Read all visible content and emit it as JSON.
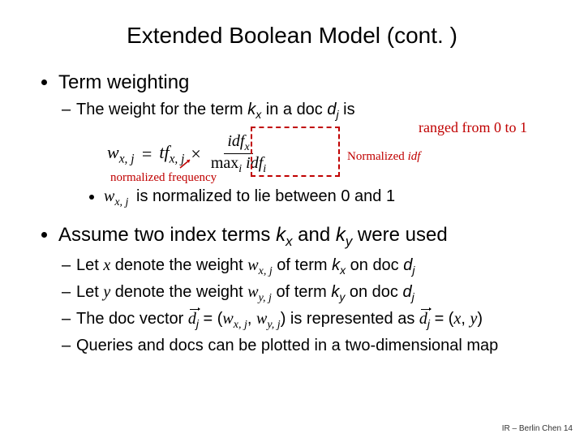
{
  "title": "Extended Boolean Model (cont. )",
  "b1": {
    "heading": "Term weighting",
    "sub1_pre": "The weight for the term ",
    "sub1_k": "k",
    "sub1_x": "x",
    "sub1_mid": " in a doc ",
    "sub1_d": "d",
    "sub1_j": "j",
    "sub1_post": " is"
  },
  "formula": {
    "lhs_w": "w",
    "lhs_sub": "x, j",
    "eq": "=",
    "tf": "tf",
    "tf_sub": "x, j",
    "times": "×",
    "num_idf": "idf",
    "num_sub": "x",
    "den_max": "max",
    "den_i": "i",
    "den_idf": " idf",
    "den_isub": "i"
  },
  "range_note": "ranged from 0 to 1",
  "norm_freq": "normalized frequency",
  "norm_idf_pre": "Normalized ",
  "norm_idf_it": "idf",
  "normline": " is normalized to lie between 0 and 1",
  "b2": {
    "heading_pre": "Assume two index terms ",
    "kx_k": "k",
    "kx_x": "x",
    "and": " and ",
    "ky_k": "k",
    "ky_y": "y",
    "heading_post": " were used",
    "l1_let": "Let ",
    "l1_x": "x",
    "l1_mid": " denote the weight ",
    "l1_w": "w",
    "l1_wsub": "x, j",
    "l1_of": " of term ",
    "l1_k": "k",
    "l1_kx": "x",
    "l1_on": " on doc ",
    "l1_d": "d",
    "l1_j": "j",
    "l2_let": "Let ",
    "l2_y": "y",
    "l2_mid": " denote the weight ",
    "l2_w": "w",
    "l2_wsub": "y, j",
    "l2_of": " of term ",
    "l2_k": "k",
    "l2_ky": "y",
    "l2_on": " on doc ",
    "l2_d": "d",
    "l2_j": "j",
    "l3_pre": "The doc vector ",
    "l3_d": "d",
    "l3_j": "j",
    "l3_eq": " = (",
    "l3_wx": "w",
    "l3_wx_sub": "x, j",
    "l3_comma": ", ",
    "l3_wy": "w",
    "l3_wy_sub": "y, j",
    "l3_close": ")",
    "l3_mid": " is represented  as ",
    "l3_d2": "d",
    "l3_j2": "j",
    "l3_eq2": " = (",
    "l3_x": "x",
    "l3_c2": ", ",
    "l3_y2": "y",
    "l3_close2": ")",
    "l4": "Queries and docs can be plotted in a two-dimensional map"
  },
  "footer": "IR – Berlin Chen 14",
  "wsymbol": "w",
  "wsymbol_sub": "x, j"
}
